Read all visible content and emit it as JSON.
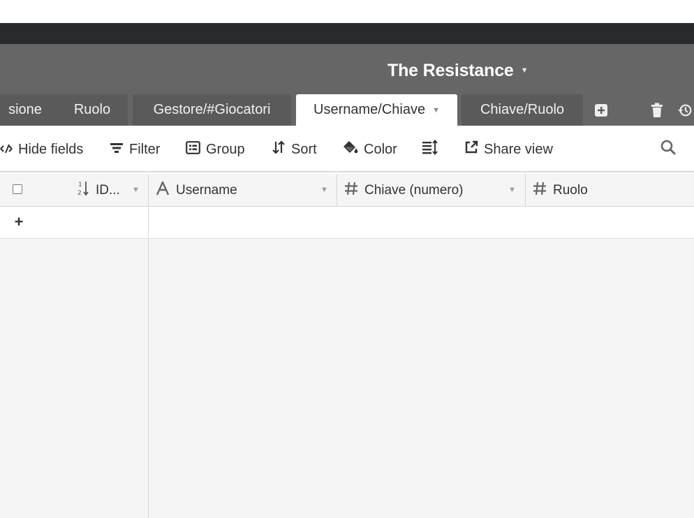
{
  "base": {
    "title": "The Resistance"
  },
  "tabs": [
    {
      "label": "sione"
    },
    {
      "label": "Ruolo"
    },
    {
      "label": "Gestore/#Giocatori"
    },
    {
      "label": "Username/Chiave",
      "active": true
    },
    {
      "label": "Chiave/Ruolo"
    }
  ],
  "toolbar": {
    "hide_fields": "Hide fields",
    "filter": "Filter",
    "group": "Group",
    "sort": "Sort",
    "color": "Color",
    "share_view": "Share view"
  },
  "columns": [
    {
      "label": "ID...",
      "icon": "autonumber-icon"
    },
    {
      "label": "Username",
      "icon": "text-field-icon"
    },
    {
      "label": "Chiave (numero)",
      "icon": "number-field-icon"
    },
    {
      "label": "Ruolo",
      "icon": "number-field-icon"
    }
  ],
  "add_row": {
    "symbol": "+"
  },
  "colors": {
    "header_bg": "#666666",
    "topbar_bg": "#282a2c",
    "tab_bg": "#5a5a5a",
    "grid_bg": "#f5f5f5"
  }
}
